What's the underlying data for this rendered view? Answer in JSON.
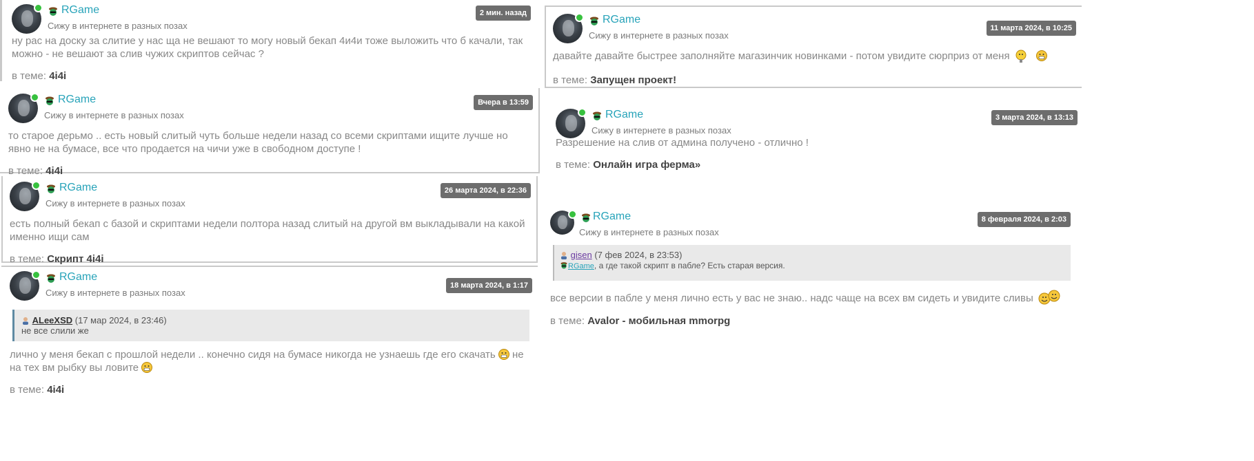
{
  "user": {
    "name": "RGame",
    "status": "Сижу в интернете в разных позах"
  },
  "topic_prefix": "в теме:",
  "posts": [
    {
      "date": "2 мин. назад",
      "text": "ну рас на доску за слитие у нас ща не вешают то могу новый бекап 4и4и тоже выложить что б качали, так можно - не вешают за слив чужих скриптов сейчас ?",
      "topic": "4i4i"
    },
    {
      "date": "Вчера в 13:59",
      "text": "то старое дерьмо .. есть новый слитый чуть больше недели назад со всеми скриптами ищите лучше но явно не на бумасе, все что продается на чичи уже в свободном доступе !",
      "topic": "4i4i"
    },
    {
      "date": "26 марта 2024, в 22:36",
      "text": "есть полный бекап с базой и скриптами недели полтора назад слитый на другой вм выкладывали на какой именно ищи сам",
      "topic": "Скрипт 4i4i"
    },
    {
      "date": "18 марта 2024, в 1:17",
      "quote_author": "ALeeXSD",
      "quote_date": "(17 мар 2024, в 23:46)",
      "quote_text": "не все слили же",
      "text_a": "лично у меня бекап с прошлой недели .. конечно сидя на бумасе никогда не узнаешь где его скачать",
      "text_b": "не на тех вм рыбку вы ловите",
      "topic": "4i4i"
    },
    {
      "date": "11 марта 2024, в 10:25",
      "text": "давайте давайте быстрее заполняйте магазинчик новинками - потом увидите сюрприз от меня",
      "topic": "Запущен проект!"
    },
    {
      "date": "3 марта 2024, в 13:13",
      "text": "Разрешение на слив от админа получено - отлично !",
      "topic": "Онлайн игра ферма»"
    },
    {
      "date": "8 февраля 2024, в 2:03",
      "quote_author": "gisen",
      "quote_date": "(7 фев 2024, в 23:53)",
      "quote_mention": "RGame",
      "quote_text": ", а где такой скрипт в пабле? Есть старая версия.",
      "text": "все версии в пабле у меня лично есть у вас не знаю.. надс чаще на всех вм сидеть и увидите сливы",
      "topic": "Avalor - мобильная mmorpg"
    }
  ]
}
